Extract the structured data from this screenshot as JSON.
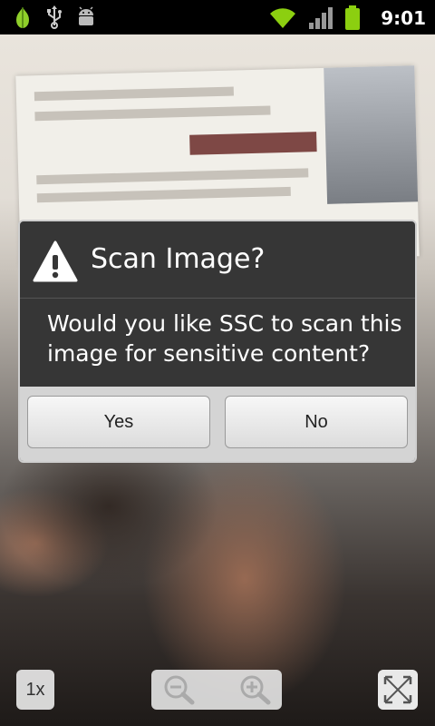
{
  "status_bar": {
    "time": "9:01",
    "icons": [
      "onion-icon",
      "usb-icon",
      "android-debug-icon",
      "wifi-icon",
      "signal-icon",
      "battery-icon"
    ]
  },
  "dialog": {
    "icon": "warning-icon",
    "title": "Scan Image?",
    "message": "Would you like SSC to scan this image for sensitive content?",
    "buttons": {
      "yes": "Yes",
      "no": "No"
    }
  },
  "controls": {
    "zoom_level_label": "1x",
    "zoom_out_icon": "zoom-out-icon",
    "zoom_in_icon": "zoom-in-icon",
    "fit_icon": "fit-screen-icon"
  },
  "colors": {
    "dialog_bg": "#363636",
    "button_bar_bg": "#d4d4d4",
    "battery_green": "#8ccf10",
    "wifi_green": "#8ccf10"
  }
}
